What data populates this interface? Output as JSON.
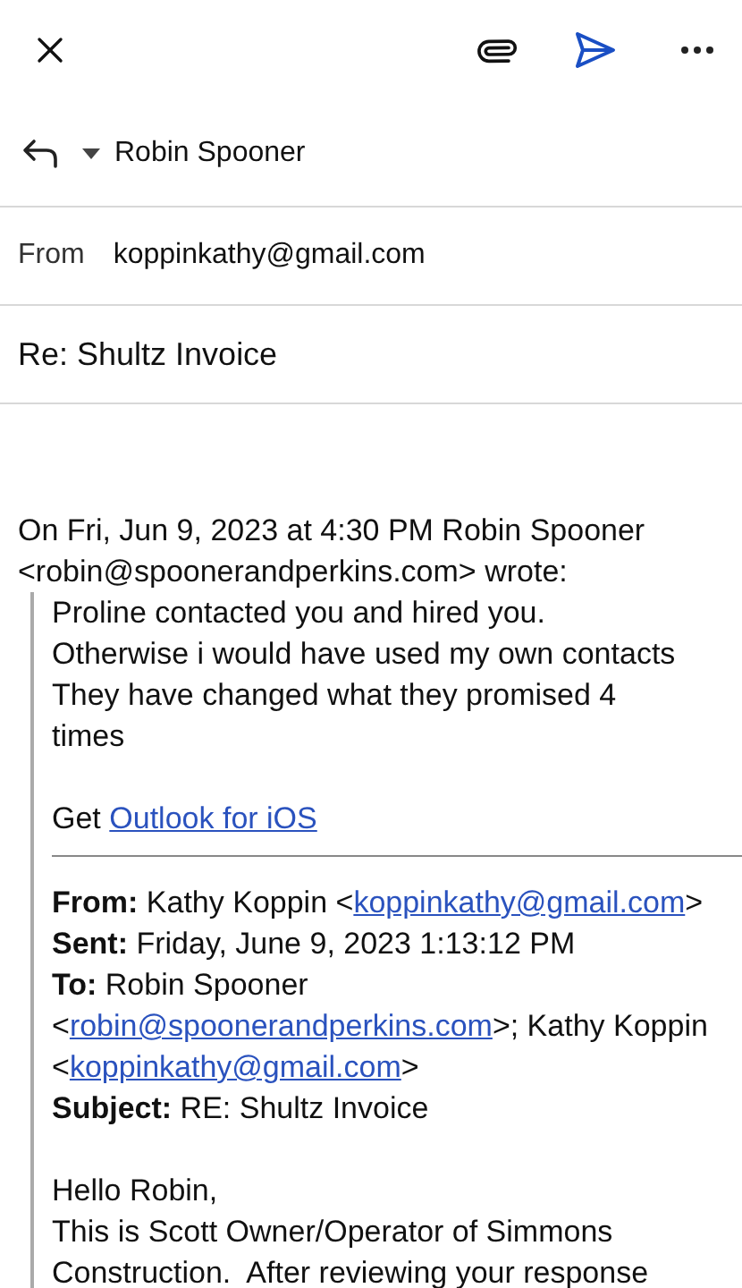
{
  "reply": {
    "recipient": "Robin Spooner"
  },
  "from": {
    "label": "From",
    "value": "koppinkathy@gmail.com"
  },
  "subject": "Re: Shultz Invoice",
  "attribution": [
    "On Fri, Jun 9, 2023 at 4:30 PM Robin Spooner",
    "<robin@spoonerandperkins.com> wrote:"
  ],
  "quote": {
    "lines": [
      "Proline contacted you and hired you.",
      "Otherwise i would have used my own contacts",
      "They have changed what they promised 4",
      "times"
    ],
    "signature": [
      {
        "kind": "text",
        "text": "Get"
      },
      {
        "kind": "link",
        "text": "Outlook for iOS"
      }
    ],
    "header": [
      [
        {
          "kind": "label",
          "text": "From:"
        },
        {
          "kind": "text",
          "text": "Kathy Koppin <"
        },
        {
          "kind": "link",
          "text": "koppinkathy@gmail.com"
        },
        {
          "kind": "text",
          "text": ">"
        }
      ],
      [
        {
          "kind": "label",
          "text": "Sent:"
        },
        {
          "kind": "text",
          "text": "Friday, June 9, 2023 1:13:12 PM"
        }
      ],
      [
        {
          "kind": "label",
          "text": "To:"
        },
        {
          "kind": "text",
          "text": "Robin Spooner"
        }
      ],
      [
        {
          "kind": "text",
          "text": "<"
        },
        {
          "kind": "link",
          "text": "robin@spoonerandperkins.com"
        },
        {
          "kind": "text",
          "text": ">; Kathy Koppin"
        }
      ],
      [
        {
          "kind": "text",
          "text": "<"
        },
        {
          "kind": "link",
          "text": "koppinkathy@gmail.com"
        },
        {
          "kind": "text",
          "text": ">"
        }
      ],
      [
        {
          "kind": "label",
          "text": "Subject:"
        },
        {
          "kind": "text",
          "text": "RE: Shultz Invoice"
        }
      ]
    ],
    "body": [
      "Hello Robin,",
      "This is Scott Owner/Operator of Simmons",
      "Construction.  After reviewing your response"
    ]
  }
}
